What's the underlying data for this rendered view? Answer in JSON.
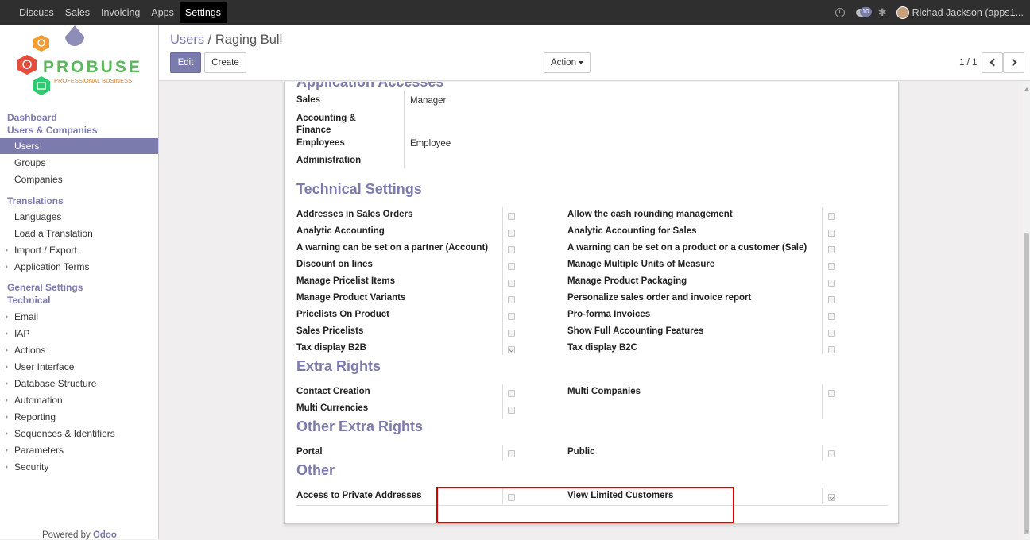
{
  "topbar": {
    "menu": [
      "Discuss",
      "Sales",
      "Invoicing",
      "Apps",
      "Settings"
    ],
    "active_menu": "Settings",
    "message_count": "10",
    "user_name": "Richad Jackson (apps1..."
  },
  "logo": {
    "brand": "PROBUSE",
    "tagline": "PROFESSIONAL BUSINESS"
  },
  "sidebar": {
    "dashboard": "Dashboard",
    "users_companies": "Users & Companies",
    "users": "Users",
    "groups": "Groups",
    "companies": "Companies",
    "translations": "Translations",
    "languages": "Languages",
    "load_translation": "Load a Translation",
    "import_export": "Import / Export",
    "application_terms": "Application Terms",
    "general_settings": "General Settings",
    "technical": "Technical",
    "email": "Email",
    "iap": "IAP",
    "actions": "Actions",
    "user_interface": "User Interface",
    "database_structure": "Database Structure",
    "automation": "Automation",
    "reporting": "Reporting",
    "sequences": "Sequences & Identifiers",
    "parameters": "Parameters",
    "security": "Security",
    "powered_prefix": "Powered by ",
    "powered_brand": "Odoo"
  },
  "control": {
    "breadcrumb_parent": "Users",
    "breadcrumb_sep": " / ",
    "breadcrumb_current": "Raging Bull",
    "edit": "Edit",
    "create": "Create",
    "action": "Action",
    "pager": "1 / 1"
  },
  "form": {
    "app_access_title": "Application Accesses",
    "app_access": {
      "sales_label": "Sales",
      "sales_value": "Manager",
      "accounting_label": "Accounting & Finance",
      "employees_label": "Employees",
      "employees_value": "Employee",
      "administration_label": "Administration"
    },
    "technical_title": "Technical Settings",
    "technical": {
      "left": [
        {
          "label": "Addresses in Sales Orders",
          "checked": false
        },
        {
          "label": "Analytic Accounting",
          "checked": false
        },
        {
          "label": "A warning can be set on a partner (Account)",
          "checked": false
        },
        {
          "label": "Discount on lines",
          "checked": false
        },
        {
          "label": "Manage Pricelist Items",
          "checked": false
        },
        {
          "label": "Manage Product Variants",
          "checked": false
        },
        {
          "label": "Pricelists On Product",
          "checked": false
        },
        {
          "label": "Sales Pricelists",
          "checked": false
        },
        {
          "label": "Tax display B2B",
          "checked": true
        }
      ],
      "right": [
        {
          "label": "Allow the cash rounding management",
          "checked": false
        },
        {
          "label": "Analytic Accounting for Sales",
          "checked": false
        },
        {
          "label": "A warning can be set on a product or a customer (Sale)",
          "checked": false
        },
        {
          "label": "Manage Multiple Units of Measure",
          "checked": false
        },
        {
          "label": "Manage Product Packaging",
          "checked": false
        },
        {
          "label": "Personalize sales order and invoice report",
          "checked": false
        },
        {
          "label": "Pro-forma Invoices",
          "checked": false
        },
        {
          "label": "Show Full Accounting Features",
          "checked": false
        },
        {
          "label": "Tax display B2C",
          "checked": false
        }
      ]
    },
    "extra_title": "Extra Rights",
    "extra": {
      "contact_creation": "Contact Creation",
      "multi_currencies": "Multi Currencies",
      "multi_companies": "Multi Companies"
    },
    "other_extra_title": "Other Extra Rights",
    "other_extra": {
      "portal": "Portal",
      "public": "Public"
    },
    "other_title": "Other",
    "other": {
      "private_addresses": "Access to Private Addresses",
      "view_limited_customers": "View Limited Customers"
    }
  },
  "colors": {
    "accent": "#7c7bad",
    "topbar": "#2f2f2f",
    "highlight": "#e00000"
  }
}
